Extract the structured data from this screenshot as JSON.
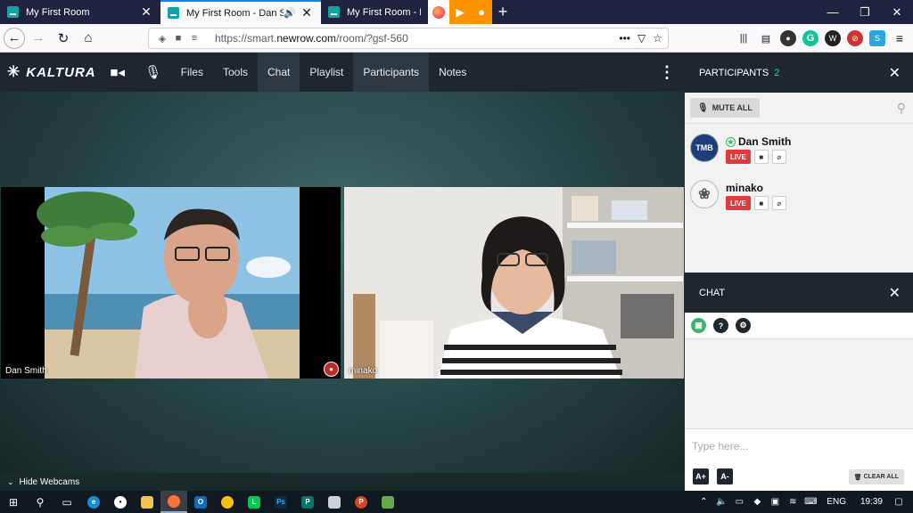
{
  "browser": {
    "tabs": [
      {
        "title": "My First Room",
        "active": false
      },
      {
        "title": "My First Room - Dan Smith",
        "active": true
      },
      {
        "title": "My First Room - Dan S",
        "active": false
      }
    ],
    "url_prefix": "https://smart.",
    "url_domain": "newrow.com",
    "url_path": "/room/?gsf-560"
  },
  "app": {
    "logo": "KALTURA",
    "menu": [
      {
        "label": "Files"
      },
      {
        "label": "Tools"
      },
      {
        "label": "Chat"
      },
      {
        "label": "Playlist"
      },
      {
        "label": "Participants"
      },
      {
        "label": "Notes"
      }
    ]
  },
  "stage": {
    "videos": [
      {
        "name": "Dan Smith"
      },
      {
        "name": "minako"
      }
    ],
    "hide_webcams_label": "Hide Webcams"
  },
  "participants": {
    "title": "PARTICIPANTS",
    "count": "2",
    "mute_all_label": "MUTE ALL",
    "list": [
      {
        "name": "Dan Smith",
        "status": "LIVE",
        "avatar_text": "TMB"
      },
      {
        "name": "minako",
        "status": "LIVE",
        "avatar_text": "❀"
      }
    ]
  },
  "chat": {
    "title": "CHAT",
    "placeholder": "Type here...",
    "font_up": "A+",
    "font_down": "A-",
    "clear_label": "CLEAR ALL"
  },
  "taskbar": {
    "language": "ENG",
    "time": "19:39"
  },
  "colors": {
    "accent": "#3bd18a",
    "live": "#e0393e",
    "header": "#1f262d"
  }
}
